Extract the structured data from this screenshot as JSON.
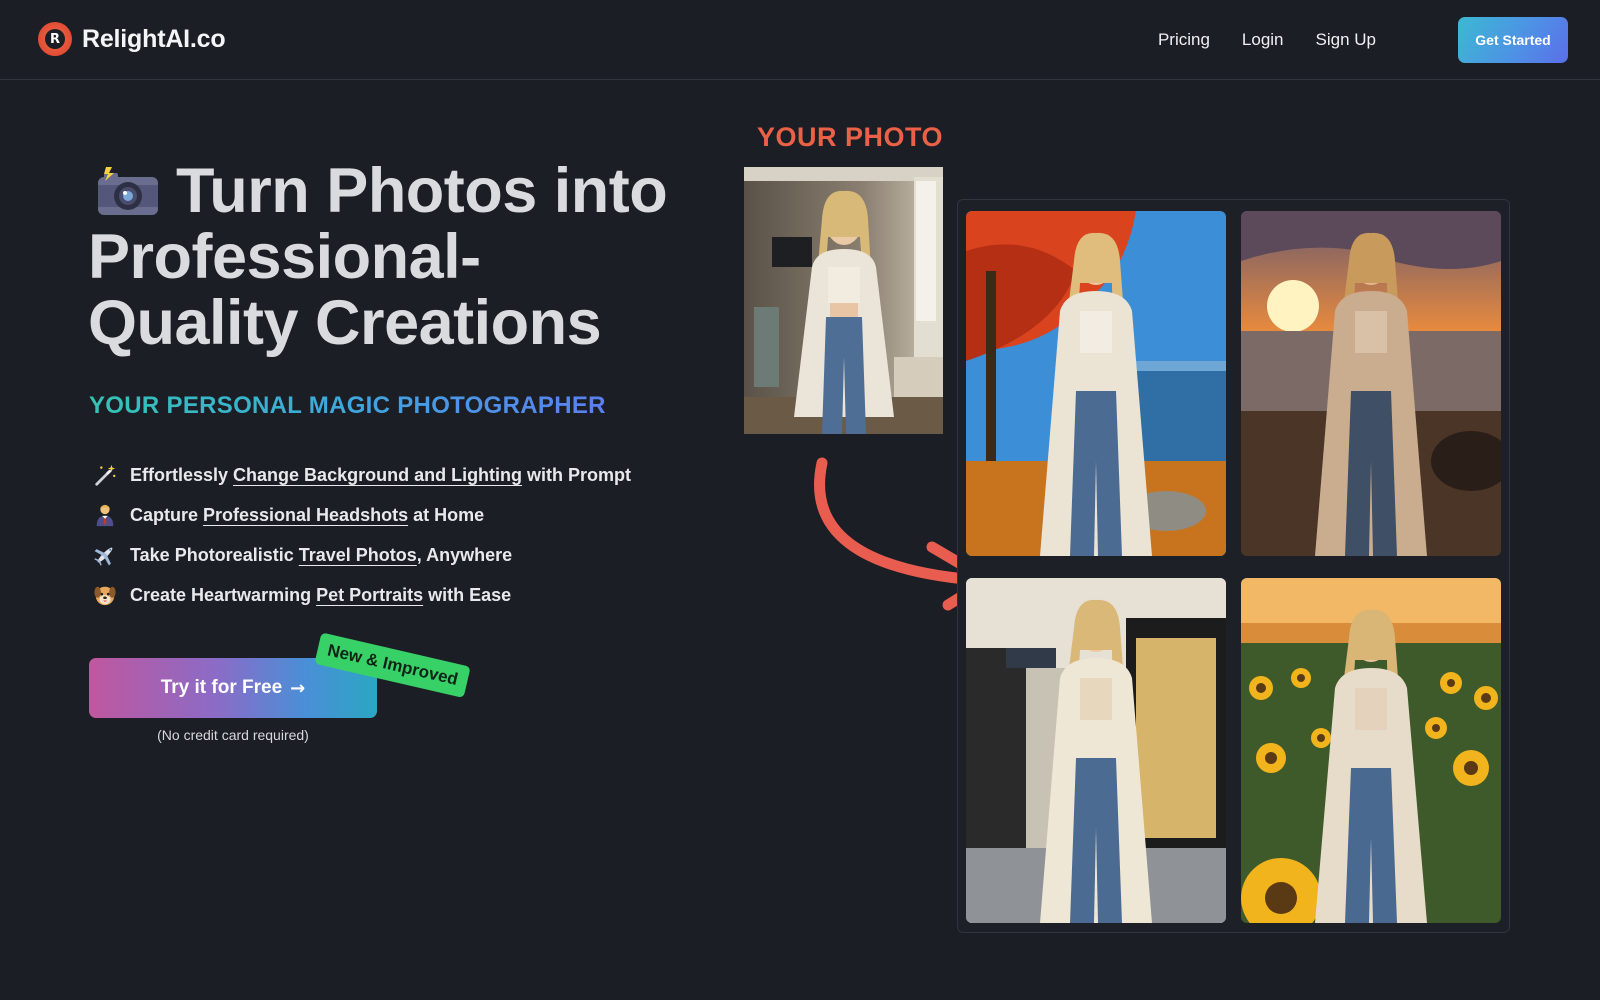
{
  "header": {
    "brand": "RelightAI.co",
    "logo_letter": "R",
    "nav": [
      "Pricing",
      "Login",
      "Sign Up"
    ],
    "cta": "Get Started"
  },
  "hero": {
    "title_line1": "Turn Photos into",
    "title_line2": "Professional-",
    "title_line3": "Quality Creations",
    "subtitle": "YOUR PERSONAL MAGIC PHOTOGRAPHER",
    "features": [
      {
        "icon": "magic-wand-icon",
        "glyph": "🪄",
        "pre": "Effortlessly ",
        "link": "Change Background and Lighting",
        "post": " with Prompt"
      },
      {
        "icon": "businessman-icon",
        "glyph": "👨‍💼",
        "pre": "Capture ",
        "link": "Professional Headshots",
        "post": " at Home"
      },
      {
        "icon": "airplane-icon",
        "glyph": "✈",
        "pre": "Take Photorealistic ",
        "link": "Travel Photos",
        "post": ", Anywhere"
      },
      {
        "icon": "dog-icon",
        "glyph": "🐶",
        "pre": "Create Heartwarming ",
        "link": "Pet Portraits",
        "post": " with Ease"
      }
    ],
    "try_button": "Try it for Free",
    "badge": "New & Improved",
    "note": "(No credit card required)"
  },
  "showcase": {
    "label": "YOUR PHOTO"
  },
  "colors": {
    "background": "#1b1e24",
    "accent_orange": "#ea6148",
    "badge_green": "#38d167"
  }
}
